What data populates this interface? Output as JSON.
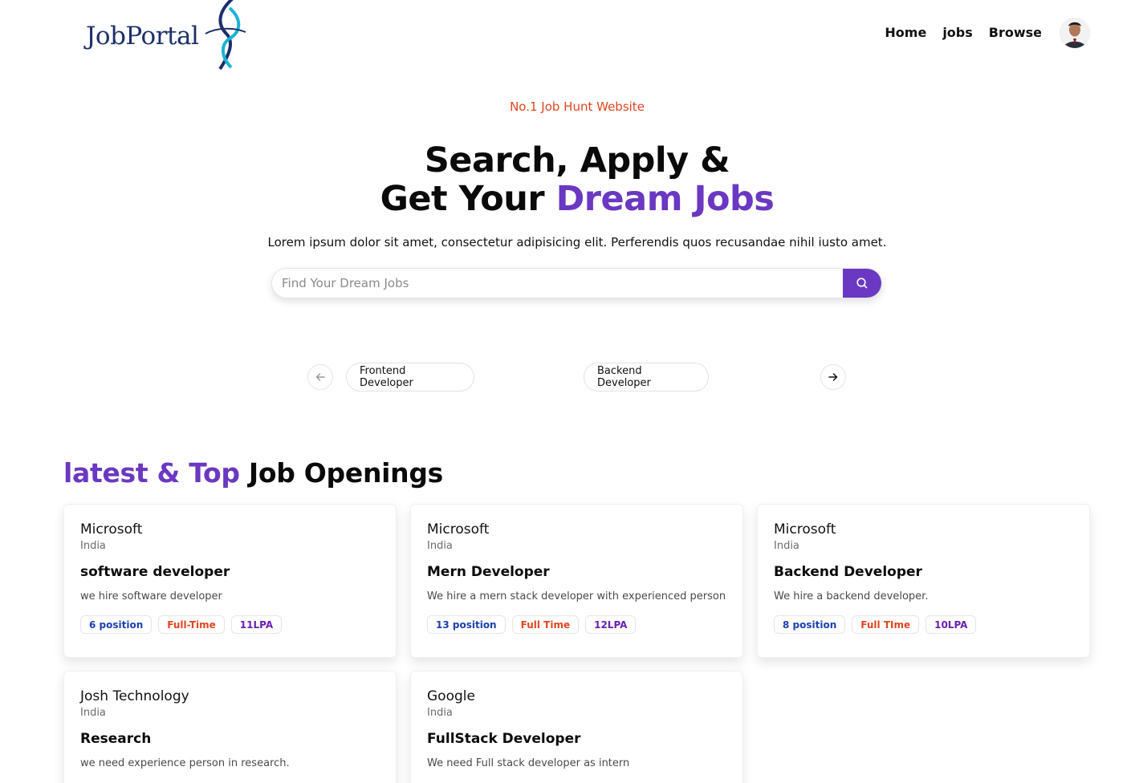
{
  "brand": {
    "logo_text": "JobPortal"
  },
  "nav": {
    "items": [
      "Home",
      "jobs",
      "Browse"
    ]
  },
  "hero": {
    "tagline": "No.1 Job Hunt Website",
    "title_line1": "Search, Apply &",
    "title_line2_prefix": "Get Your ",
    "title_line2_accent": "Dream Jobs",
    "subtitle": "Lorem ipsum dolor sit amet, consectetur adipisicing elit. Perferendis quos recusandae nihil iusto amet."
  },
  "search": {
    "placeholder": "Find Your Dream Jobs",
    "value": ""
  },
  "carousel": {
    "items": [
      "Frontend Developer",
      "Backend Developer"
    ]
  },
  "section": {
    "title_accent": "latest & Top",
    "title_rest": " Job Openings"
  },
  "jobs": [
    {
      "company": "Microsoft",
      "location": "India",
      "title": "software developer",
      "description": "we hire software developer",
      "positions": "6 position",
      "type": "Full-Time",
      "salary": "11LPA"
    },
    {
      "company": "Microsoft",
      "location": "India",
      "title": "Mern Developer",
      "description": "We hire a mern stack developer with experienced person",
      "positions": "13 position",
      "type": "Full Time",
      "salary": "12LPA"
    },
    {
      "company": "Microsoft",
      "location": "India",
      "title": "Backend Developer",
      "description": "We hire a backend developer.",
      "positions": "8 position",
      "type": "Full TIme",
      "salary": "10LPA"
    },
    {
      "company": "Josh Technology",
      "location": "India",
      "title": "Research",
      "description": "we need experience person in research."
    },
    {
      "company": "Google",
      "location": "India",
      "title": "FullStack Developer",
      "description": "We need Full stack developer as intern"
    }
  ],
  "colors": {
    "accent": "#6a38c2",
    "tagline": "#e0461f",
    "badge_positions": "#1d40af",
    "badge_type": "#e0461f",
    "badge_salary": "#6a1fb2"
  },
  "icons": {
    "search": "search-icon",
    "prev": "arrow-left-icon",
    "next": "arrow-right-icon"
  }
}
